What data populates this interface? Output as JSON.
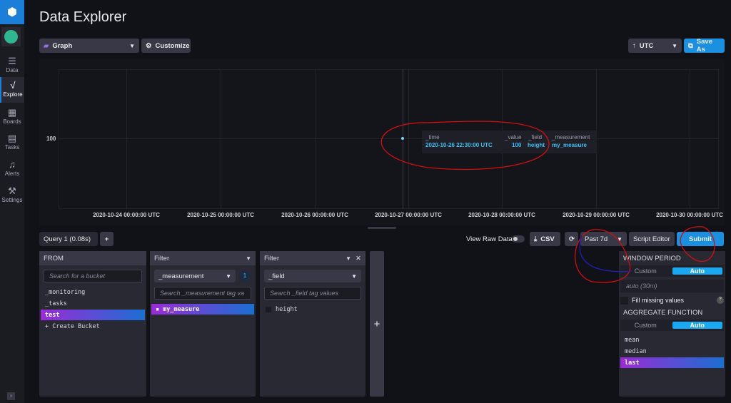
{
  "sidebar": {
    "items": [
      {
        "label": "Data",
        "icon": "database-icon"
      },
      {
        "label": "Explore",
        "icon": "explore-icon"
      },
      {
        "label": "Boards",
        "icon": "boards-icon"
      },
      {
        "label": "Tasks",
        "icon": "calendar-icon"
      },
      {
        "label": "Alerts",
        "icon": "bell-icon"
      },
      {
        "label": "Settings",
        "icon": "wrench-icon"
      }
    ]
  },
  "header": {
    "title": "Data Explorer"
  },
  "toolbar": {
    "view_type": "Graph",
    "customize": "Customize",
    "timezone": "UTC",
    "save_as": "Save As"
  },
  "graph": {
    "y_tick": "100",
    "x_ticks": [
      "2020-10-24 00:00:00 UTC",
      "2020-10-25 00:00:00 UTC",
      "2020-10-26 00:00:00 UTC",
      "2020-10-27 00:00:00 UTC",
      "2020-10-28 00:00:00 UTC",
      "2020-10-29 00:00:00 UTC",
      "2020-10-30 00:00:00 UTC"
    ],
    "tooltip": {
      "headers": [
        "_time",
        "_value",
        "_field",
        "_measurement"
      ],
      "values": [
        "2020-10-26 22:30:00 UTC",
        "100",
        "height",
        "my_measure"
      ]
    }
  },
  "query_bar": {
    "tab": "Query 1 (0.08s)",
    "add": "+",
    "view_raw": "View Raw Data",
    "csv": "CSV",
    "time_range": "Past 7d",
    "script_editor": "Script Editor",
    "submit": "Submit"
  },
  "from": {
    "title": "FROM",
    "placeholder": "Search for a bucket",
    "buckets": [
      "_monitoring",
      "_tasks",
      "test"
    ],
    "create": "+ Create Bucket"
  },
  "filter1": {
    "title": "Filter",
    "key": "_measurement",
    "count": "1",
    "placeholder": "Search _measurement tag va",
    "values": [
      "my_measure"
    ]
  },
  "filter2": {
    "title": "Filter",
    "key": "_field",
    "placeholder": "Search _field tag values",
    "values": [
      "height"
    ]
  },
  "add_filter": "+",
  "window": {
    "title": "WINDOW PERIOD",
    "custom": "Custom",
    "auto": "Auto",
    "value": "auto (30m)",
    "fill": "Fill missing values",
    "help": "?"
  },
  "aggregate": {
    "title": "AGGREGATE FUNCTION",
    "custom": "Custom",
    "auto": "Auto",
    "functions": [
      "mean",
      "median",
      "last"
    ]
  }
}
